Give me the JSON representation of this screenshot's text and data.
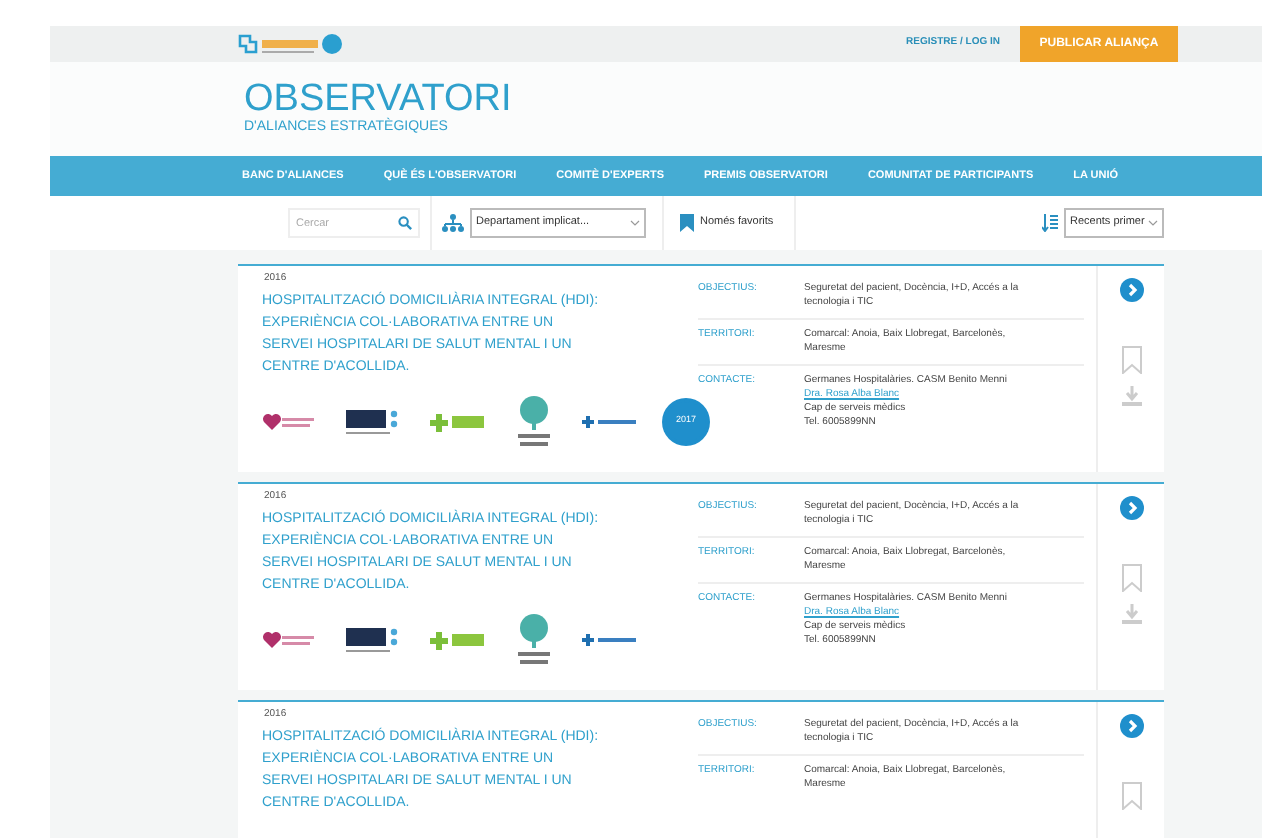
{
  "header": {
    "login_link": "REGISTRE / LOG IN",
    "publish_button": "PUBLICAR ALIANÇA"
  },
  "page_title": {
    "title": "OBSERVATORI",
    "subtitle": "D'ALIANCES ESTRATÈGIQUES"
  },
  "nav": [
    {
      "label": "BANC D'ALIANCES"
    },
    {
      "label": "QUÈ ÉS L'OBSERVATORI"
    },
    {
      "label": "COMITÈ  D'EXPERTS"
    },
    {
      "label": "PREMIS OBSERVATORI"
    },
    {
      "label": "COMUNITAT DE PARTICIPANTS"
    },
    {
      "label": "LA UNIÓ"
    }
  ],
  "filters": {
    "search": {
      "placeholder": "Cercar"
    },
    "department": {
      "value": "Departament implicat..."
    },
    "favorites": {
      "label": "Només favorits"
    },
    "sort": {
      "value": "Recents primer"
    }
  },
  "cards": [
    {
      "year": "2016",
      "title": "HOSPITALITZACIÓ DOMICILIÀRIA INTEGRAL (HDI): EXPERIÈNCIA COL·LABORATIVA ENTRE UN SERVEI HOSPITALARI DE SALUT MENTAL I UN CENTRE D'ACOLLIDA.",
      "logos": true,
      "award": "2017",
      "details": [
        {
          "label": "OBJECTIUS:",
          "lines": [
            "Seguretat del pacient, Docència, I+D, Accés a la tecnologia i TIC"
          ]
        },
        {
          "label": "TERRITORI:",
          "lines": [
            "Comarcal: Anoia, Baix Llobregat, Barcelonès, Maresme"
          ]
        },
        {
          "label": "CONTACTE:",
          "lines": [
            "Germanes Hospitalàries. CASM Benito Menni"
          ],
          "link": "Dra. Rosa Alba Blanc",
          "extra": [
            "Cap de serveis mèdics",
            "Tel. 6005899NN"
          ]
        }
      ]
    },
    {
      "year": "2016",
      "title": "HOSPITALITZACIÓ DOMICILIÀRIA INTEGRAL (HDI): EXPERIÈNCIA COL·LABORATIVA ENTRE UN SERVEI HOSPITALARI DE SALUT MENTAL I UN CENTRE D'ACOLLIDA.",
      "logos": true,
      "details": [
        {
          "label": "OBJECTIUS:",
          "lines": [
            "Seguretat del pacient, Docència, I+D, Accés a la tecnologia i TIC"
          ]
        },
        {
          "label": "TERRITORI:",
          "lines": [
            "Comarcal: Anoia, Baix Llobregat, Barcelonès, Maresme"
          ]
        },
        {
          "label": "CONTACTE:",
          "lines": [
            "Germanes Hospitalàries. CASM Benito Menni"
          ],
          "link": "Dra. Rosa Alba Blanc",
          "extra": [
            "Cap de serveis mèdics",
            "Tel. 6005899NN"
          ]
        }
      ]
    },
    {
      "year": "2016",
      "title": "HOSPITALITZACIÓ DOMICILIÀRIA INTEGRAL (HDI): EXPERIÈNCIA COL·LABORATIVA ENTRE UN SERVEI HOSPITALARI DE SALUT MENTAL I UN CENTRE D'ACOLLIDA.",
      "logos": false,
      "details": [
        {
          "label": "OBJECTIUS:",
          "lines": [
            "Seguretat del pacient, Docència, I+D, Accés a la tecnologia i TIC"
          ]
        },
        {
          "label": "TERRITORI:",
          "lines": [
            "Comarcal: Anoia, Baix Llobregat, Barcelonès, Maresme"
          ]
        }
      ]
    }
  ]
}
